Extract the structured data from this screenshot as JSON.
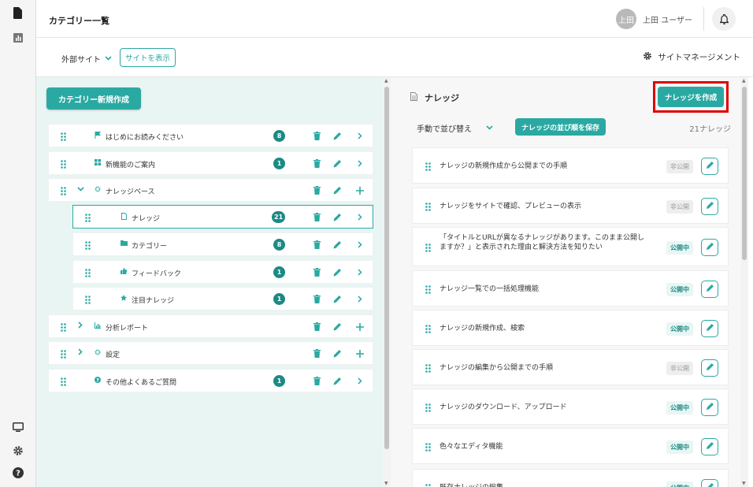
{
  "header": {
    "title": "カテゴリー一覧",
    "user": {
      "avatar_text": "上田",
      "name": "上田 ユーザー"
    }
  },
  "subheader": {
    "site_select": "外部サイト",
    "view_site_label": "サイトを表示",
    "site_management_label": "サイトマネージメント"
  },
  "left": {
    "create_category_label": "カテゴリー新規作成",
    "rows": [
      {
        "label": "はじめにお読みください",
        "icon": "flag-icon",
        "badge": "8",
        "action": "chevron"
      },
      {
        "label": "新機能のご案内",
        "icon": "grid-icon",
        "badge": "1",
        "action": "chevron"
      },
      {
        "label": "ナレッジベース",
        "icon": "gear-icon",
        "badge": "",
        "action": "plus",
        "expanded": true
      },
      {
        "label": "ナレッジ",
        "icon": "document-icon",
        "badge": "21",
        "action": "chevron",
        "child": true,
        "selected": true
      },
      {
        "label": "カテゴリー",
        "icon": "folder-icon",
        "badge": "8",
        "action": "chevron",
        "child": true
      },
      {
        "label": "フィードバック",
        "icon": "thumbs-up-icon",
        "badge": "1",
        "action": "chevron",
        "child": true
      },
      {
        "label": "注目ナレッジ",
        "icon": "star-icon",
        "badge": "1",
        "action": "chevron",
        "child": true
      },
      {
        "label": "分析レポート",
        "icon": "chart-icon",
        "badge": "",
        "action": "plus",
        "expanded": false
      },
      {
        "label": "設定",
        "icon": "gear-icon",
        "badge": "",
        "action": "plus",
        "expanded": false
      },
      {
        "label": "その他よくあるご質問",
        "icon": "question-icon",
        "badge": "1",
        "action": "chevron"
      }
    ]
  },
  "right": {
    "title": "ナレッジ",
    "create_knowledge_label": "ナレッジを作成",
    "sort_select": "手動で並び替え",
    "save_order_label": "ナレッジの並び順を保存",
    "count_label": "21ナレッジ",
    "status_labels": {
      "unpublished": "非公開",
      "published": "公開中"
    },
    "items": [
      {
        "title": "ナレッジの新規作成から公開までの手順",
        "status": "非公開"
      },
      {
        "title": "ナレッジをサイトで確認、プレビューの表示",
        "status": "非公開"
      },
      {
        "title": "「タイトルとURLが異なるナレッジがあります。このまま公開しますか？」と表示された理由と解決方法を知りたい",
        "status": "公開中"
      },
      {
        "title": "ナレッジ一覧での一括処理機能",
        "status": "公開中"
      },
      {
        "title": "ナレッジの新規作成、検索",
        "status": "公開中"
      },
      {
        "title": "ナレッジの編集から公開までの手順",
        "status": "非公開"
      },
      {
        "title": "ナレッジのダウンロード、アップロード",
        "status": "公開中"
      },
      {
        "title": "色々なエディタ機能",
        "status": "公開中"
      },
      {
        "title": "既存ナレッジの編集",
        "status": "公開中"
      }
    ]
  },
  "colors": {
    "accent": "#2aa9a3",
    "accent_dark": "#1c8a84",
    "highlight": "#e00000"
  }
}
